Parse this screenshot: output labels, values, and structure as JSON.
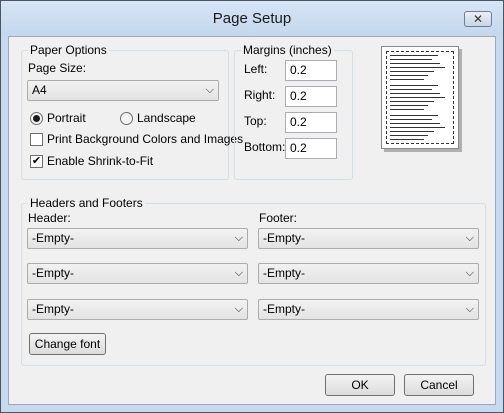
{
  "window": {
    "title": "Page Setup",
    "close_glyph": "✕"
  },
  "paper": {
    "group_label": "Paper Options",
    "size_label": "Page Size:",
    "size_value": "A4",
    "portrait_label": "Portrait",
    "landscape_label": "Landscape",
    "orientation": "portrait",
    "print_bg_label": "Print Background Colors and Images",
    "print_bg_checked": false,
    "shrink_label": "Enable Shrink-to-Fit",
    "shrink_checked": true
  },
  "margins": {
    "group_label": "Margins (inches)",
    "left_label": "Left:",
    "left_value": "0.2",
    "right_label": "Right:",
    "right_value": "0.2",
    "top_label": "Top:",
    "top_value": "0.2",
    "bottom_label": "Bottom:",
    "bottom_value": "0.2"
  },
  "headers_footers": {
    "group_label": "Headers and Footers",
    "header_label": "Header:",
    "footer_label": "Footer:",
    "header_values": [
      "-Empty-",
      "-Empty-",
      "-Empty-"
    ],
    "footer_values": [
      "-Empty-",
      "-Empty-",
      "-Empty-"
    ],
    "change_font_label": "Change font"
  },
  "buttons": {
    "ok_label": "OK",
    "cancel_label": "Cancel"
  },
  "icons": {
    "dropdown": "chevron-down-icon",
    "close": "close-icon",
    "check": "checkmark-icon"
  }
}
